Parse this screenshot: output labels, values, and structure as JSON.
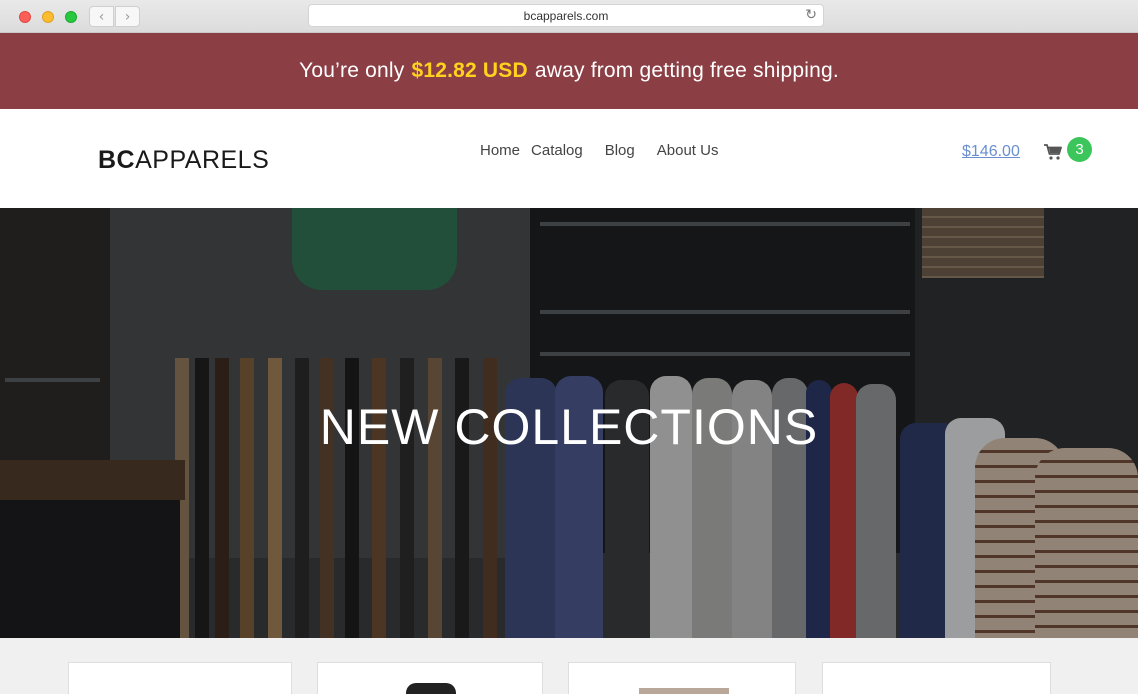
{
  "browser": {
    "url": "bcapparels.com",
    "back_icon": "chevron-left-icon",
    "forward_icon": "chevron-right-icon",
    "reload_icon": "reload-icon"
  },
  "banner": {
    "prefix": "You’re only",
    "amount": "$12.82 USD",
    "suffix": "away from getting free shipping.",
    "bg_color": "#8b3f45",
    "amount_color": "#ffd21e"
  },
  "header": {
    "logo_bold": "BC",
    "logo_rest": "APPARELS",
    "nav": [
      {
        "label": "Home"
      },
      {
        "label": "Catalog"
      },
      {
        "label": "Blog"
      },
      {
        "label": "About Us"
      }
    ],
    "cart_total": "$146.00",
    "cart_icon": "cart-icon",
    "cart_count": "3",
    "cart_badge_color": "#3cc55a"
  },
  "hero": {
    "title": "NEW COLLECTIONS"
  }
}
